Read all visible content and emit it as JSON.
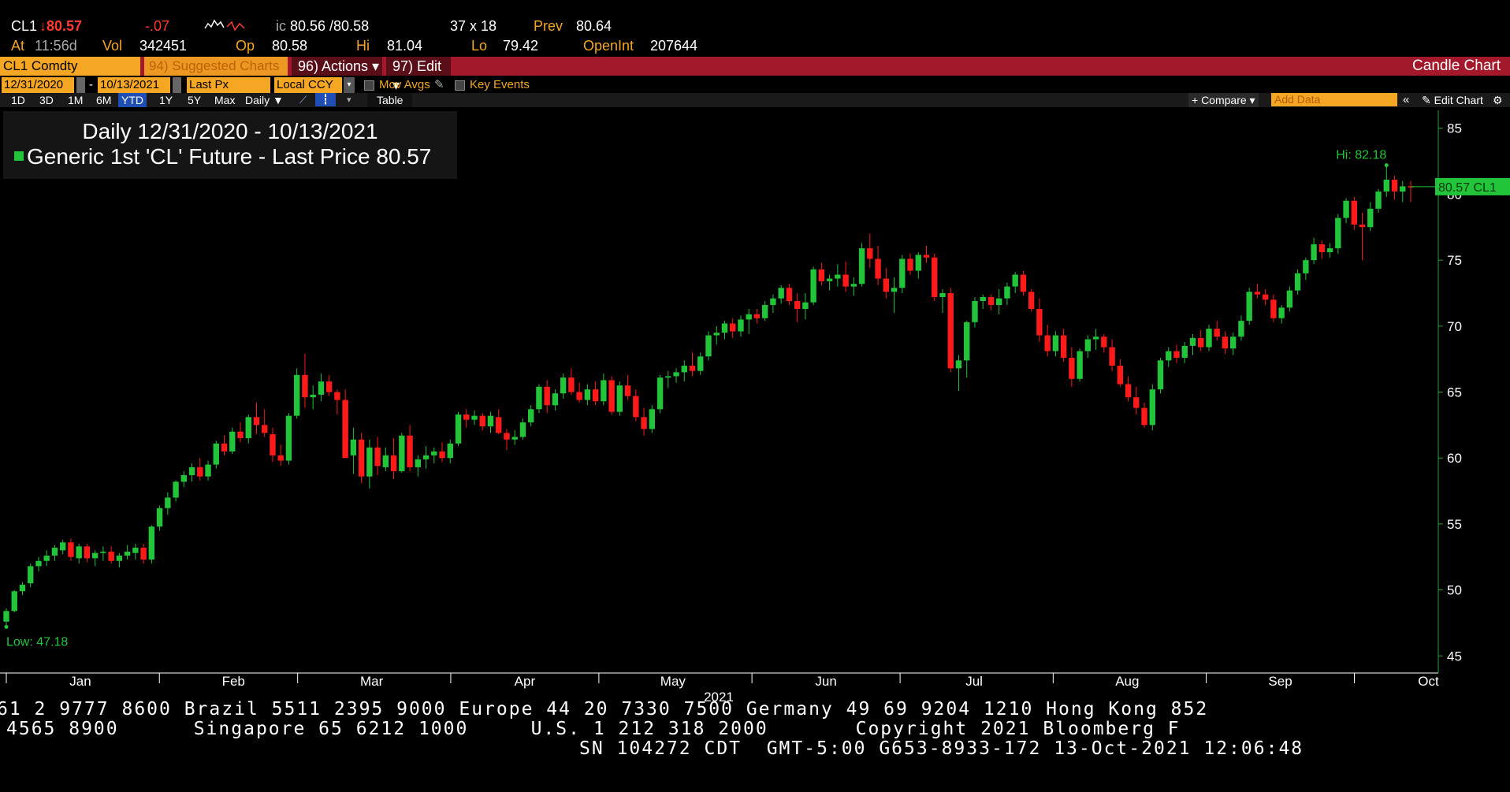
{
  "quote": {
    "ticker": "CL1",
    "last_price": "↓80.57",
    "change": "-.07",
    "bid_ask_prefix": "ic",
    "bid_ask": "80.56 /80.58",
    "size": "37 x 18",
    "prev_label": "Prev",
    "prev": "80.64",
    "at_label": "At",
    "time": "11:56d",
    "vol_label": "Vol",
    "vol": "342451",
    "op_label": "Op",
    "op": "80.58",
    "hi_label": "Hi",
    "hi": "81.04",
    "lo_label": "Lo",
    "lo": "79.42",
    "openint_label": "OpenInt",
    "openint": "207644"
  },
  "toolbar": {
    "security": "CL1 Comdty",
    "suggested": "94) Suggested Charts",
    "actions": "96) Actions ▾",
    "edit": "97) Edit ▾",
    "chart_type": "Candle Chart"
  },
  "settings": {
    "start_date": "12/31/2020",
    "end_date": "10/13/2021",
    "field": "Last Px",
    "currency": "Local CCY",
    "mov_avgs": "Mov Avgs",
    "key_events": "Key Events"
  },
  "periods": [
    "1D",
    "3D",
    "1M",
    "6M",
    "YTD",
    "1Y",
    "5Y",
    "Max"
  ],
  "selected_period": "YTD",
  "frequency": "Daily ▼",
  "table_label": "Table",
  "compare_label": "+ Compare ▾",
  "add_data_placeholder": "Add Data",
  "edit_chart_label": "✎ Edit Chart",
  "legend": {
    "title": "Daily 12/31/2020 - 10/13/2021",
    "series": "Generic 1st 'CL' Future - Last Price",
    "last": "80.57"
  },
  "colors": {
    "up": "#22c43a",
    "down": "#ff1a1a",
    "accent": "#f5a623",
    "bar": "#a3192b"
  },
  "chart_data": {
    "type": "candlestick",
    "ylim": [
      44,
      86
    ],
    "yticks": [
      45,
      50,
      55,
      60,
      65,
      70,
      75,
      80,
      85
    ],
    "xlabel": "2021",
    "months": [
      {
        "label": "Jan",
        "day": 1
      },
      {
        "label": "Feb",
        "day": 32
      },
      {
        "label": "Mar",
        "day": 60
      },
      {
        "label": "Apr",
        "day": 91
      },
      {
        "label": "May",
        "day": 121
      },
      {
        "label": "Jun",
        "day": 152
      },
      {
        "label": "Jul",
        "day": 182
      },
      {
        "label": "Aug",
        "day": 213
      },
      {
        "label": "Sep",
        "day": 244
      },
      {
        "label": "Oct",
        "day": 274
      }
    ],
    "hi_annotation": "Hi: 82.18",
    "low_annotation": "Low: 47.18",
    "last_label": "80.57 CL1",
    "last_value": 80.57,
    "candles": [
      [
        47.6,
        48.6,
        47.2,
        48.4
      ],
      [
        48.4,
        50.0,
        48.3,
        49.9
      ],
      [
        49.9,
        50.6,
        49.6,
        50.4
      ],
      [
        50.5,
        52.0,
        50.2,
        51.8
      ],
      [
        51.8,
        52.5,
        51.4,
        52.2
      ],
      [
        52.2,
        53.0,
        51.8,
        52.6
      ],
      [
        52.6,
        53.4,
        52.2,
        53.2
      ],
      [
        53.0,
        53.8,
        52.7,
        53.6
      ],
      [
        53.6,
        53.9,
        52.2,
        52.5
      ],
      [
        52.4,
        53.5,
        52.0,
        53.3
      ],
      [
        53.3,
        53.5,
        52.1,
        52.4
      ],
      [
        52.4,
        53.0,
        51.8,
        52.8
      ],
      [
        52.8,
        53.3,
        52.2,
        52.9
      ],
      [
        52.9,
        53.3,
        52.0,
        52.2
      ],
      [
        52.2,
        52.8,
        51.7,
        52.6
      ],
      [
        52.6,
        53.4,
        52.3,
        52.9
      ],
      [
        52.8,
        53.5,
        52.3,
        53.2
      ],
      [
        53.2,
        53.5,
        52.0,
        52.3
      ],
      [
        52.3,
        54.9,
        52.0,
        54.8
      ],
      [
        54.8,
        56.4,
        54.5,
        56.2
      ],
      [
        56.2,
        57.4,
        55.7,
        57.0
      ],
      [
        57.0,
        58.3,
        56.7,
        58.2
      ],
      [
        58.2,
        59.0,
        57.8,
        58.7
      ],
      [
        58.7,
        59.6,
        58.2,
        59.3
      ],
      [
        59.3,
        60.0,
        58.3,
        58.6
      ],
      [
        58.6,
        59.8,
        58.3,
        59.5
      ],
      [
        59.5,
        61.3,
        59.2,
        61.1
      ],
      [
        61.1,
        61.7,
        60.2,
        60.5
      ],
      [
        60.5,
        62.3,
        60.3,
        62.0
      ],
      [
        62.0,
        62.7,
        61.2,
        61.5
      ],
      [
        61.5,
        63.3,
        61.1,
        63.1
      ],
      [
        63.1,
        64.2,
        61.8,
        62.5
      ],
      [
        62.5,
        63.7,
        61.6,
        61.9
      ],
      [
        61.8,
        62.3,
        59.7,
        60.2
      ],
      [
        60.2,
        61.0,
        59.4,
        59.8
      ],
      [
        59.8,
        63.4,
        59.5,
        63.2
      ],
      [
        63.2,
        66.8,
        63.0,
        66.3
      ],
      [
        66.3,
        67.9,
        63.8,
        64.6
      ],
      [
        64.6,
        65.5,
        63.7,
        64.8
      ],
      [
        64.8,
        66.4,
        64.3,
        65.8
      ],
      [
        65.8,
        66.3,
        64.7,
        65.0
      ],
      [
        65.0,
        65.2,
        63.3,
        64.4
      ],
      [
        64.4,
        65.2,
        60.0,
        60.0
      ],
      [
        60.2,
        62.3,
        58.8,
        61.4
      ],
      [
        61.4,
        61.9,
        58.1,
        58.6
      ],
      [
        58.6,
        61.4,
        57.7,
        60.8
      ],
      [
        60.8,
        61.6,
        58.7,
        59.4
      ],
      [
        59.3,
        60.8,
        59.0,
        60.2
      ],
      [
        60.2,
        61.5,
        58.4,
        59.0
      ],
      [
        59.0,
        61.9,
        58.9,
        61.7
      ],
      [
        61.7,
        62.5,
        59.0,
        59.3
      ],
      [
        59.3,
        60.2,
        58.6,
        59.9
      ],
      [
        59.9,
        60.9,
        59.2,
        60.2
      ],
      [
        60.2,
        60.8,
        59.6,
        60.5
      ],
      [
        60.5,
        61.2,
        59.7,
        60.0
      ],
      [
        60.0,
        61.4,
        59.6,
        61.1
      ],
      [
        61.1,
        63.5,
        60.9,
        63.3
      ],
      [
        63.3,
        63.7,
        62.3,
        62.9
      ],
      [
        62.9,
        63.6,
        62.5,
        63.2
      ],
      [
        63.2,
        63.4,
        62.1,
        62.4
      ],
      [
        62.4,
        63.5,
        61.9,
        63.2
      ],
      [
        63.1,
        63.7,
        61.8,
        61.9
      ],
      [
        61.9,
        62.2,
        60.6,
        61.4
      ],
      [
        61.4,
        62.1,
        61.0,
        61.6
      ],
      [
        61.6,
        63.0,
        61.4,
        62.7
      ],
      [
        62.7,
        64.0,
        62.4,
        63.7
      ],
      [
        63.7,
        65.6,
        63.4,
        65.4
      ],
      [
        65.4,
        65.9,
        63.4,
        64.0
      ],
      [
        64.0,
        65.2,
        63.6,
        64.9
      ],
      [
        64.9,
        66.4,
        64.5,
        66.1
      ],
      [
        66.1,
        66.8,
        64.8,
        65.0
      ],
      [
        65.0,
        65.7,
        64.2,
        64.4
      ],
      [
        64.4,
        65.6,
        64.0,
        65.2
      ],
      [
        65.2,
        65.8,
        64.0,
        64.3
      ],
      [
        64.3,
        66.4,
        64.0,
        65.9
      ],
      [
        65.9,
        66.2,
        63.3,
        63.5
      ],
      [
        63.5,
        65.8,
        63.2,
        65.5
      ],
      [
        65.5,
        66.3,
        64.4,
        64.7
      ],
      [
        64.7,
        65.2,
        62.8,
        63.1
      ],
      [
        63.1,
        63.8,
        61.7,
        62.2
      ],
      [
        62.2,
        64.0,
        61.9,
        63.7
      ],
      [
        63.7,
        66.3,
        63.4,
        66.1
      ],
      [
        66.1,
        66.6,
        65.3,
        66.2
      ],
      [
        66.2,
        66.8,
        65.7,
        66.5
      ],
      [
        66.5,
        67.4,
        65.8,
        67.0
      ],
      [
        67.0,
        68.0,
        66.2,
        66.6
      ],
      [
        66.6,
        68.0,
        66.3,
        67.7
      ],
      [
        67.7,
        69.6,
        67.4,
        69.3
      ],
      [
        69.3,
        70.0,
        68.6,
        69.5
      ],
      [
        69.5,
        70.4,
        69.0,
        70.2
      ],
      [
        70.2,
        70.6,
        69.1,
        69.6
      ],
      [
        69.6,
        70.8,
        69.2,
        70.5
      ],
      [
        70.5,
        71.3,
        69.4,
        70.9
      ],
      [
        70.9,
        71.3,
        70.2,
        70.6
      ],
      [
        70.6,
        71.9,
        70.4,
        71.6
      ],
      [
        71.6,
        72.4,
        71.0,
        72.1
      ],
      [
        72.1,
        73.1,
        71.7,
        72.9
      ],
      [
        72.9,
        73.2,
        71.6,
        71.9
      ],
      [
        71.9,
        72.5,
        70.3,
        71.3
      ],
      [
        71.3,
        72.5,
        70.5,
        71.8
      ],
      [
        71.8,
        74.5,
        71.6,
        74.3
      ],
      [
        74.3,
        74.8,
        73.1,
        73.4
      ],
      [
        73.4,
        73.9,
        72.7,
        73.6
      ],
      [
        73.6,
        74.7,
        73.0,
        73.9
      ],
      [
        73.9,
        74.9,
        72.6,
        73.0
      ],
      [
        73.0,
        73.7,
        72.3,
        73.2
      ],
      [
        73.2,
        76.3,
        73.0,
        75.9
      ],
      [
        75.9,
        77.0,
        74.4,
        75.1
      ],
      [
        75.1,
        76.1,
        73.1,
        73.6
      ],
      [
        73.6,
        74.4,
        72.1,
        72.6
      ],
      [
        72.6,
        73.7,
        71.0,
        72.9
      ],
      [
        72.9,
        75.4,
        72.5,
        75.1
      ],
      [
        75.1,
        75.5,
        73.9,
        74.2
      ],
      [
        74.2,
        75.6,
        73.6,
        75.4
      ],
      [
        75.4,
        76.1,
        74.8,
        75.2
      ],
      [
        75.2,
        75.5,
        71.9,
        72.2
      ],
      [
        72.2,
        72.8,
        71.0,
        72.5
      ],
      [
        72.5,
        72.9,
        66.5,
        66.8
      ],
      [
        66.8,
        67.8,
        65.1,
        67.4
      ],
      [
        67.4,
        70.4,
        66.1,
        70.3
      ],
      [
        70.3,
        72.2,
        69.9,
        71.9
      ],
      [
        71.9,
        72.4,
        71.3,
        72.2
      ],
      [
        72.2,
        72.4,
        71.2,
        71.6
      ],
      [
        71.6,
        72.8,
        70.9,
        72.1
      ],
      [
        72.1,
        73.3,
        71.6,
        73.0
      ],
      [
        73.0,
        74.1,
        72.5,
        73.9
      ],
      [
        73.9,
        74.2,
        72.3,
        72.6
      ],
      [
        72.6,
        72.8,
        71.1,
        71.3
      ],
      [
        71.3,
        72.1,
        68.8,
        69.3
      ],
      [
        69.3,
        70.1,
        67.7,
        68.1
      ],
      [
        68.1,
        69.6,
        67.7,
        69.3
      ],
      [
        69.3,
        69.8,
        67.3,
        67.6
      ],
      [
        67.6,
        68.4,
        65.4,
        66.0
      ],
      [
        66.0,
        68.3,
        65.8,
        68.1
      ],
      [
        68.1,
        69.3,
        67.6,
        69.0
      ],
      [
        69.0,
        69.8,
        68.2,
        69.2
      ],
      [
        69.2,
        69.4,
        68.0,
        68.4
      ],
      [
        68.4,
        69.0,
        66.6,
        67.0
      ],
      [
        67.0,
        67.5,
        65.4,
        65.6
      ],
      [
        65.6,
        66.2,
        64.3,
        64.6
      ],
      [
        64.6,
        65.4,
        63.3,
        63.8
      ],
      [
        63.8,
        64.2,
        62.3,
        62.5
      ],
      [
        62.5,
        65.6,
        62.1,
        65.2
      ],
      [
        65.2,
        67.6,
        64.9,
        67.4
      ],
      [
        67.4,
        68.4,
        66.9,
        68.1
      ],
      [
        68.1,
        68.6,
        67.2,
        67.6
      ],
      [
        67.6,
        68.8,
        67.2,
        68.5
      ],
      [
        68.5,
        69.4,
        67.8,
        69.1
      ],
      [
        69.1,
        69.7,
        68.1,
        68.4
      ],
      [
        68.4,
        70.1,
        68.1,
        69.8
      ],
      [
        69.8,
        70.4,
        68.9,
        69.2
      ],
      [
        69.2,
        69.6,
        67.9,
        68.3
      ],
      [
        68.3,
        69.5,
        67.8,
        69.2
      ],
      [
        69.2,
        70.8,
        68.9,
        70.4
      ],
      [
        70.4,
        72.9,
        70.1,
        72.6
      ],
      [
        72.6,
        73.2,
        72.1,
        72.4
      ],
      [
        72.4,
        72.8,
        71.6,
        72.0
      ],
      [
        72.0,
        72.4,
        70.3,
        70.6
      ],
      [
        70.6,
        71.6,
        70.2,
        71.4
      ],
      [
        71.4,
        73.0,
        71.1,
        72.7
      ],
      [
        72.7,
        74.3,
        72.4,
        74.0
      ],
      [
        74.0,
        75.2,
        73.5,
        75.0
      ],
      [
        75.0,
        76.7,
        74.7,
        76.2
      ],
      [
        76.2,
        76.5,
        75.1,
        75.6
      ],
      [
        75.6,
        76.3,
        75.2,
        75.9
      ],
      [
        75.9,
        78.5,
        75.5,
        78.2
      ],
      [
        78.2,
        79.7,
        77.8,
        79.5
      ],
      [
        79.5,
        79.8,
        77.3,
        77.7
      ],
      [
        77.7,
        78.6,
        75.0,
        77.5
      ],
      [
        77.5,
        79.4,
        77.2,
        78.9
      ],
      [
        78.9,
        80.4,
        78.6,
        80.2
      ],
      [
        80.2,
        82.2,
        79.8,
        81.1
      ],
      [
        81.1,
        81.4,
        79.6,
        80.2
      ],
      [
        80.2,
        81.0,
        79.4,
        80.6
      ],
      [
        80.6,
        81.0,
        79.4,
        80.57
      ]
    ]
  }
}
